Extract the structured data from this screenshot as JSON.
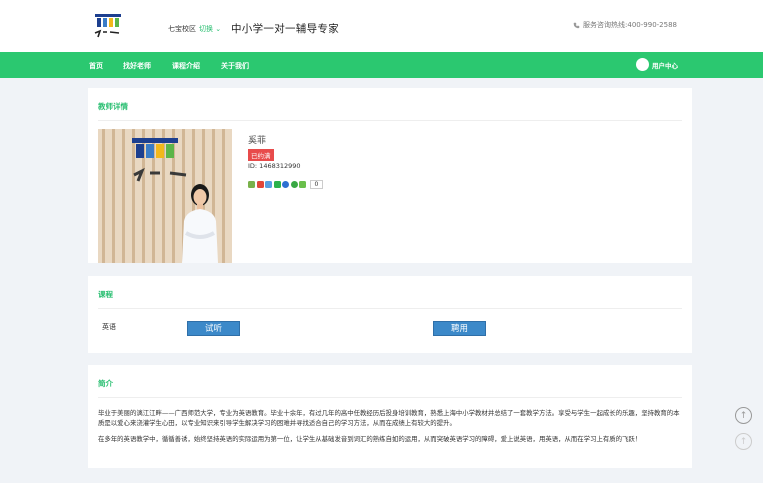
{
  "header": {
    "campus": "七宝校区",
    "switch_label": "切换",
    "slogan": "中小学一对一辅导专家",
    "hotline": "服务咨询热线:400-990-2588"
  },
  "nav": {
    "items": [
      "首页",
      "找好老师",
      "课程介绍",
      "关于我们"
    ],
    "user_center": "用户中心"
  },
  "teacher": {
    "section_title": "教师详情",
    "name": "奚菲",
    "status_badge": "已约满",
    "id_text": "ID: 1468312990",
    "share_count": "0"
  },
  "courses": {
    "section_title": "课程",
    "rows": [
      {
        "subject": "英语",
        "trial_label": "试听",
        "hire_label": "聘用"
      }
    ]
  },
  "intro": {
    "section_title": "简介",
    "paragraphs": [
      "毕业于美丽的漓江江畔——广西师范大学，专业为英语教育。毕业十余年，有过几年的高中任教经历后投身培训教育，熟悉上海中小学教材并总结了一套教学方法。享受与学生一起成长的乐趣，坚持教育的本质是以爱心来浇灌学生心田，以专业知识来引导学生解决学习的困难并寻找适合自己的学习方法，从而在成绩上有较大的提升。",
      "在多年的英语教学中，循循善诱，始终坚持英语的实际运用为第一位，让学生从基础发音到词汇的熟练自如的运用，从而突破英语学习的障碍，爱上说英语，用英语，从而在学习上有质的飞跃！"
    ]
  },
  "colors": {
    "brand_green": "#2bc870",
    "button_blue": "#3c89c9",
    "badge_red": "#e84b4b"
  }
}
